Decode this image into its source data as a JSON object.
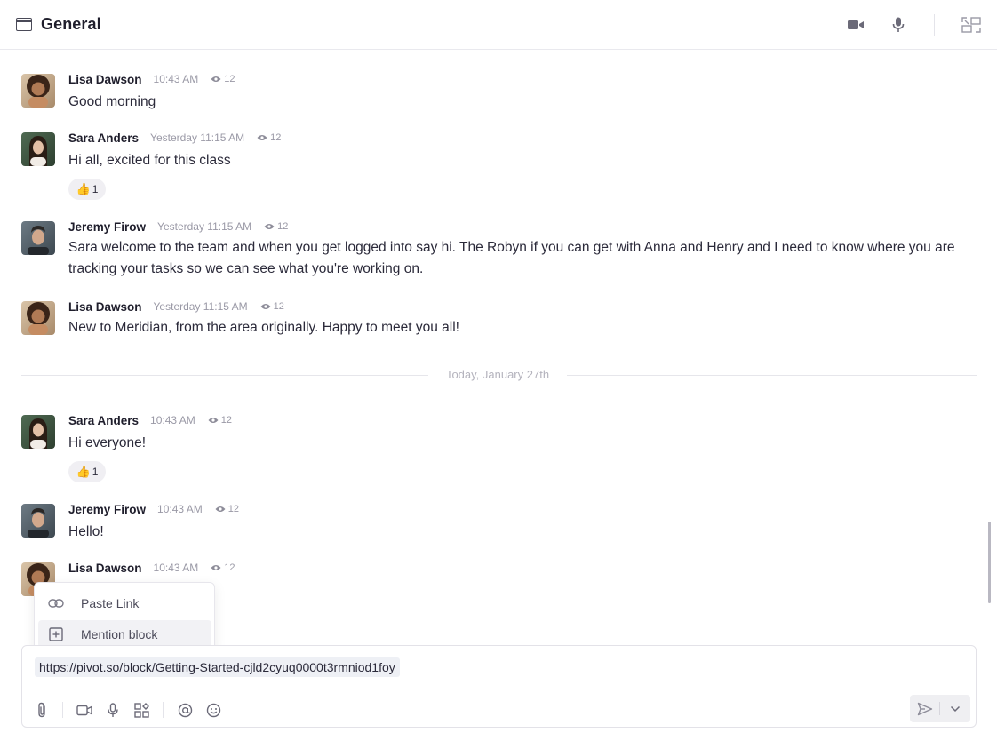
{
  "header": {
    "title": "General",
    "icons": [
      "window-icon",
      "video-camera-icon",
      "microphone-icon",
      "collapse-icon"
    ]
  },
  "messages": [
    {
      "author": "Lisa Dawson",
      "time": "10:43 AM",
      "views": "12",
      "text": "Good morning",
      "avatar": "avatar-lisa"
    },
    {
      "author": "Sara Anders",
      "time": "Yesterday 11:15 AM",
      "views": "12",
      "text": "Hi all, excited for this class",
      "avatar": "avatar-sara",
      "reaction": {
        "emoji": "👍",
        "count": "1"
      }
    },
    {
      "author": "Jeremy Firow",
      "time": "Yesterday 11:15 AM",
      "views": "12",
      "text": "Sara welcome to the team and when you get logged into say hi. The Robyn if you can get with Anna and Henry and I need to know where you are tracking your tasks so we can see what you're working on.",
      "avatar": "avatar-jeremy"
    },
    {
      "author": "Lisa Dawson",
      "time": "Yesterday 11:15 AM",
      "views": "12",
      "text": "New to Meridian, from the area originally. Happy to meet you all!",
      "avatar": "avatar-lisa"
    },
    {
      "author": "Sara Anders",
      "time": "10:43 AM",
      "views": "12",
      "text": "Hi everyone!",
      "avatar": "avatar-sara",
      "reaction": {
        "emoji": "👍",
        "count": "1"
      }
    },
    {
      "author": "Jeremy Firow",
      "time": "10:43 AM",
      "views": "12",
      "text": "Hello!",
      "avatar": "avatar-jeremy"
    },
    {
      "author": "Lisa Dawson",
      "time": "10:43 AM",
      "views": "12",
      "text": "",
      "avatar": "avatar-lisa"
    }
  ],
  "divider": {
    "label": "Today, January 27th"
  },
  "popup": {
    "items": [
      {
        "label": "Paste Link",
        "icon": "link-icon"
      },
      {
        "label": "Mention block",
        "icon": "plus-square-icon",
        "active": true
      }
    ]
  },
  "composer": {
    "value": "https://pivot.so/block/Getting-Started-cjld2cyuq0000t3rmniod1foy",
    "tools": [
      "paperclip-icon",
      "video-camera-icon",
      "microphone-icon",
      "apps-icon",
      "at-icon",
      "emoji-icon"
    ],
    "send_icon": "send-icon",
    "dropdown_icon": "chevron-down-icon"
  },
  "colors": {
    "text": "#2b2a3a",
    "muted": "#9a99a6",
    "border": "#e3e2e8",
    "link_bg": "#eef0f5"
  }
}
